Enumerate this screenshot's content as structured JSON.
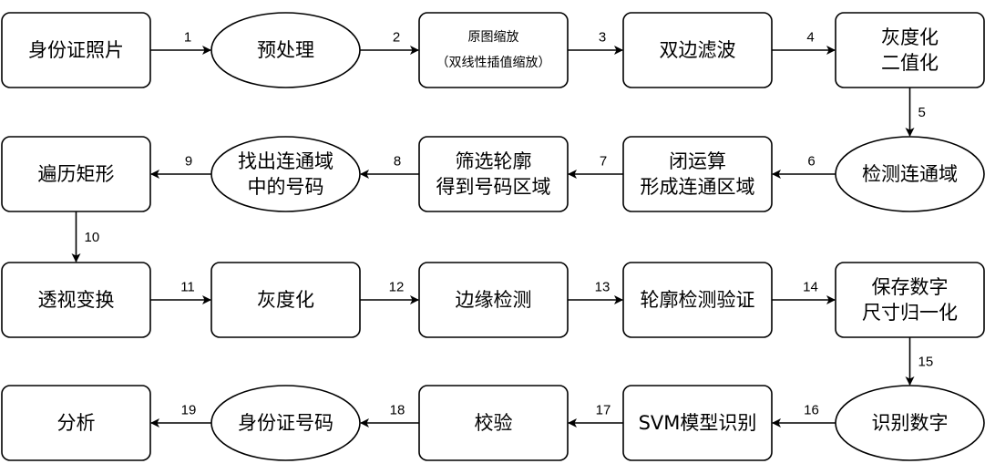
{
  "nodes": [
    {
      "id": "n1",
      "shape": "rect",
      "lines": [
        "身份证照片"
      ]
    },
    {
      "id": "n2",
      "shape": "ellipse",
      "lines": [
        "预处理"
      ]
    },
    {
      "id": "n3",
      "shape": "rect",
      "lines": [
        "原图缩放",
        "（双线性插值缩放）"
      ],
      "small": true
    },
    {
      "id": "n4",
      "shape": "rect",
      "lines": [
        "双边滤波"
      ]
    },
    {
      "id": "n5",
      "shape": "rect",
      "lines": [
        "灰度化",
        "二值化"
      ]
    },
    {
      "id": "n6",
      "shape": "ellipse",
      "lines": [
        "检测连通域"
      ]
    },
    {
      "id": "n7",
      "shape": "rect",
      "lines": [
        "闭运算",
        "形成连通区域"
      ]
    },
    {
      "id": "n8",
      "shape": "rect",
      "lines": [
        "筛选轮廓",
        "得到号码区域"
      ]
    },
    {
      "id": "n9",
      "shape": "ellipse",
      "lines": [
        "找出连通域",
        "中的号码"
      ]
    },
    {
      "id": "n10",
      "shape": "rect",
      "lines": [
        "遍历矩形"
      ]
    },
    {
      "id": "n11",
      "shape": "rect",
      "lines": [
        "透视变换"
      ]
    },
    {
      "id": "n12",
      "shape": "rect",
      "lines": [
        "灰度化"
      ]
    },
    {
      "id": "n13",
      "shape": "rect",
      "lines": [
        "边缘检测"
      ]
    },
    {
      "id": "n14",
      "shape": "rect",
      "lines": [
        "轮廓检测验证"
      ]
    },
    {
      "id": "n15",
      "shape": "rect",
      "lines": [
        "保存数字",
        "尺寸归一化"
      ]
    },
    {
      "id": "n16",
      "shape": "ellipse",
      "lines": [
        "识别数字"
      ]
    },
    {
      "id": "n17",
      "shape": "rect",
      "lines": [
        "SVM模型识别"
      ]
    },
    {
      "id": "n18",
      "shape": "rect",
      "lines": [
        "校验"
      ]
    },
    {
      "id": "n19",
      "shape": "ellipse",
      "lines": [
        "身份证号码"
      ]
    },
    {
      "id": "n20",
      "shape": "rect",
      "lines": [
        "分析"
      ]
    }
  ],
  "edges": [
    {
      "from": "n1",
      "to": "n2",
      "label": "1"
    },
    {
      "from": "n2",
      "to": "n3",
      "label": "2"
    },
    {
      "from": "n3",
      "to": "n4",
      "label": "3"
    },
    {
      "from": "n4",
      "to": "n5",
      "label": "4"
    },
    {
      "from": "n5",
      "to": "n6",
      "label": "5"
    },
    {
      "from": "n6",
      "to": "n7",
      "label": "6"
    },
    {
      "from": "n7",
      "to": "n8",
      "label": "7"
    },
    {
      "from": "n8",
      "to": "n9",
      "label": "8"
    },
    {
      "from": "n9",
      "to": "n10",
      "label": "9"
    },
    {
      "from": "n10",
      "to": "n11",
      "label": "10"
    },
    {
      "from": "n11",
      "to": "n12",
      "label": "11"
    },
    {
      "from": "n12",
      "to": "n13",
      "label": "12"
    },
    {
      "from": "n13",
      "to": "n14",
      "label": "13"
    },
    {
      "from": "n14",
      "to": "n15",
      "label": "14"
    },
    {
      "from": "n15",
      "to": "n16",
      "label": "15"
    },
    {
      "from": "n16",
      "to": "n17",
      "label": "16"
    },
    {
      "from": "n17",
      "to": "n18",
      "label": "17"
    },
    {
      "from": "n18",
      "to": "n19",
      "label": "18"
    },
    {
      "from": "n19",
      "to": "n20",
      "label": "19"
    }
  ]
}
